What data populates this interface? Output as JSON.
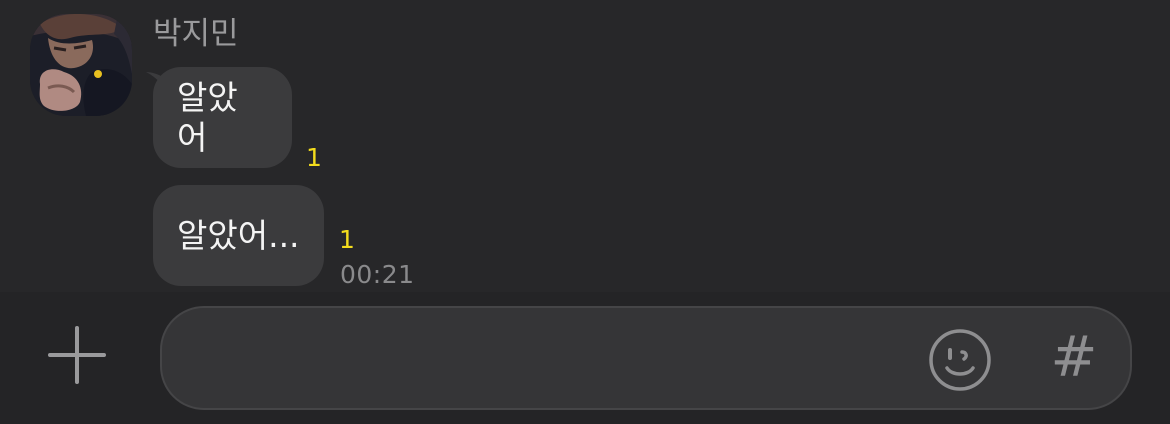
{
  "conversation": {
    "sender_name": "박지민",
    "messages": [
      {
        "text": "알았어",
        "unread_count": "1"
      },
      {
        "text": "알았어...",
        "unread_count": "1",
        "time": "00:21"
      }
    ]
  },
  "composer": {
    "input_value": "",
    "hashtag_label": "#",
    "icons": {
      "attach": "plus-icon",
      "emoticon": "smiley-icon"
    }
  },
  "colors": {
    "background": "#272729",
    "bubble": "#3b3b3d",
    "unread_badge": "#f3dc1d",
    "input_bar": "#242426"
  }
}
